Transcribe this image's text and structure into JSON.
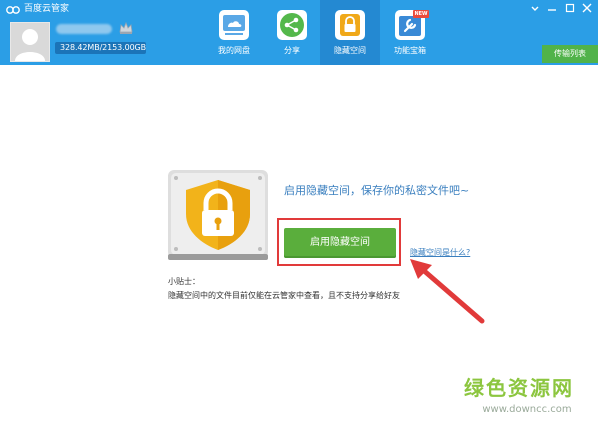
{
  "app": {
    "title": "百度云管家"
  },
  "user": {
    "quota": "328.42MB/2153.00GB"
  },
  "nav": {
    "tabs": [
      {
        "label": "我的网盘",
        "icon": "cloud-drive-icon"
      },
      {
        "label": "分享",
        "icon": "share-icon"
      },
      {
        "label": "隐藏空间",
        "icon": "lock-icon",
        "active": true
      },
      {
        "label": "功能宝箱",
        "icon": "toolbox-icon",
        "badge": "NEW"
      }
    ]
  },
  "window_controls": [
    "menu-icon",
    "minimize-icon",
    "maximize-icon",
    "close-icon"
  ],
  "transfer": {
    "label": "传输列表"
  },
  "main": {
    "headline": "启用隐藏空间，保存你的私密文件吧~",
    "enable_button": "启用隐藏空间",
    "what_link": "隐藏空间是什么?",
    "tip_title": "小贴士：",
    "tip_text": "隐藏空间中的文件目前仅能在云管家中查看，且不支持分享给好友"
  },
  "watermark": {
    "logo": "绿色资源网",
    "url": "www.downcc.com"
  },
  "colors": {
    "header": "#2b9ee6",
    "active_tab": "#2489d2",
    "button": "#5aae3c",
    "highlight": "#e13a3a",
    "link": "#3a7fbf"
  }
}
